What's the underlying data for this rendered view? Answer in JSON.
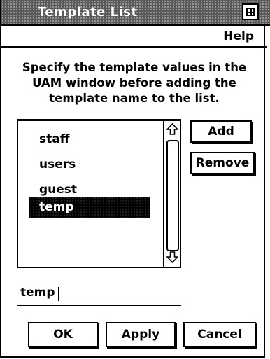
{
  "window": {
    "title": "Template List",
    "maximize_icon": "maximize-icon"
  },
  "menubar": {
    "help_label": "Help"
  },
  "instructions": "Specify the template values in the UAM window before adding the template name to the list.",
  "list": {
    "items": [
      "staff",
      "users",
      "guest",
      "temp"
    ],
    "selected": "temp",
    "scroll_up_icon": "scroll-up-arrow-icon",
    "scroll_down_icon": "scroll-down-arrow-icon"
  },
  "side_buttons": {
    "add_label": "Add",
    "remove_label": "Remove"
  },
  "input": {
    "value": "temp"
  },
  "footer": {
    "ok_label": "OK",
    "apply_label": "Apply",
    "cancel_label": "Cancel"
  }
}
